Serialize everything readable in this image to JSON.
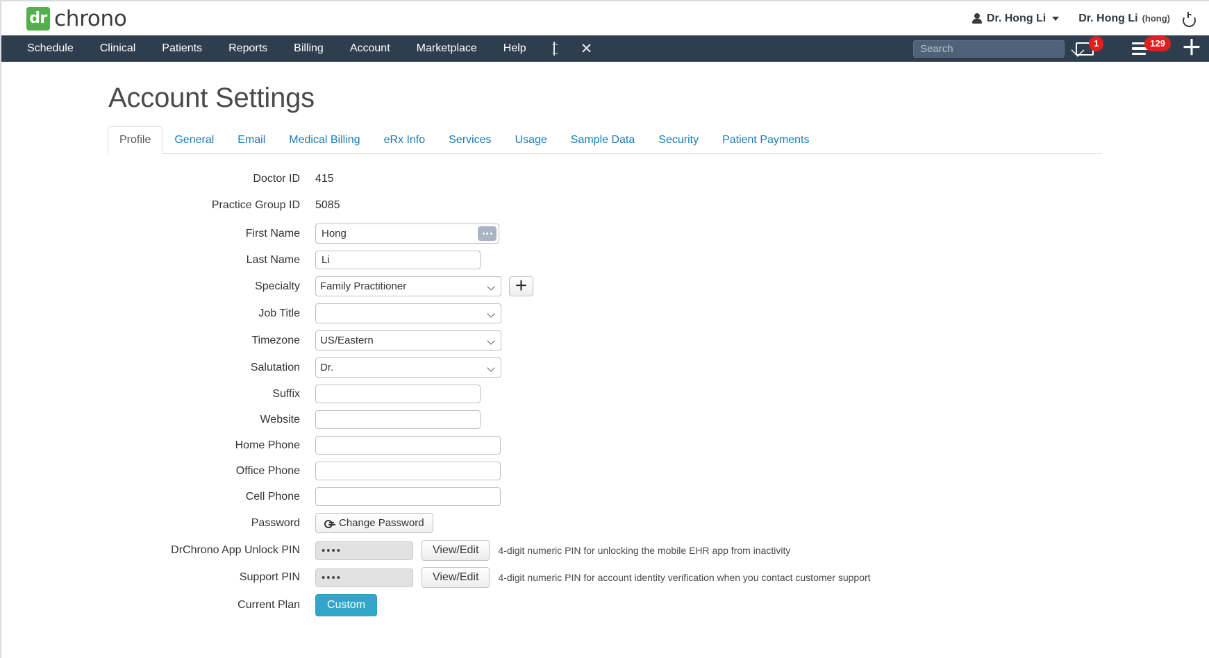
{
  "brand": {
    "logo_badge": "dr",
    "logo_text": "chrono"
  },
  "topbar": {
    "user_menu_label": "Dr. Hong Li",
    "user_display": "Dr. Hong Li",
    "user_login": "(hong)",
    "person_icon": "person-icon",
    "caret_icon": "chevron-down-icon",
    "power_icon": "power-icon"
  },
  "nav": {
    "items": [
      {
        "label": "Schedule"
      },
      {
        "label": "Clinical"
      },
      {
        "label": "Patients"
      },
      {
        "label": "Reports"
      },
      {
        "label": "Billing"
      },
      {
        "label": "Account"
      },
      {
        "label": "Marketplace"
      },
      {
        "label": "Help"
      }
    ],
    "icons": [
      {
        "name": "caduceus-icon"
      },
      {
        "name": "x-close-icon",
        "glyph": "✕"
      }
    ],
    "search_placeholder": "Search",
    "search_value": "",
    "messages_badge": "1",
    "tasks_badge": "129",
    "plus_glyph": "＋"
  },
  "page": {
    "title": "Account Settings"
  },
  "tabs": [
    {
      "label": "Profile",
      "active": true
    },
    {
      "label": "General",
      "active": false
    },
    {
      "label": "Email",
      "active": false
    },
    {
      "label": "Medical Billing",
      "active": false
    },
    {
      "label": "eRx Info",
      "active": false
    },
    {
      "label": "Services",
      "active": false
    },
    {
      "label": "Usage",
      "active": false
    },
    {
      "label": "Sample Data",
      "active": false
    },
    {
      "label": "Security",
      "active": false
    },
    {
      "label": "Patient Payments",
      "active": false
    }
  ],
  "form": {
    "doctor_id": {
      "label": "Doctor ID",
      "value": "415"
    },
    "practice_group_id": {
      "label": "Practice Group ID",
      "value": "5085"
    },
    "first_name": {
      "label": "First Name",
      "value": "Hong"
    },
    "last_name": {
      "label": "Last Name",
      "value": "Li"
    },
    "specialty": {
      "label": "Specialty",
      "value": "Family Practitioner",
      "add_button": "＋"
    },
    "job_title": {
      "label": "Job Title",
      "value": ""
    },
    "timezone": {
      "label": "Timezone",
      "value": "US/Eastern"
    },
    "salutation": {
      "label": "Salutation",
      "value": "Dr."
    },
    "suffix": {
      "label": "Suffix",
      "value": ""
    },
    "website": {
      "label": "Website",
      "value": ""
    },
    "home_phone": {
      "label": "Home Phone",
      "value": ""
    },
    "office_phone": {
      "label": "Office Phone",
      "value": ""
    },
    "cell_phone": {
      "label": "Cell Phone",
      "value": ""
    },
    "password": {
      "label": "Password",
      "button": "Change Password"
    },
    "app_unlock_pin": {
      "label": "DrChrono App Unlock PIN",
      "value": "••••",
      "button": "View/Edit",
      "help": "4-digit numeric PIN for unlocking the mobile EHR app from inactivity"
    },
    "support_pin": {
      "label": "Support PIN",
      "value": "••••",
      "button": "View/Edit",
      "help": "4-digit numeric PIN for account identity verification when you contact customer support"
    },
    "current_plan": {
      "label": "Current Plan",
      "value": "Custom"
    }
  },
  "colors": {
    "nav_bg": "#2f3e4e",
    "logo_green": "#53b04d",
    "link_blue": "#1a7bb9",
    "badge_red": "#e02020",
    "plan_teal": "#32a5c9"
  }
}
